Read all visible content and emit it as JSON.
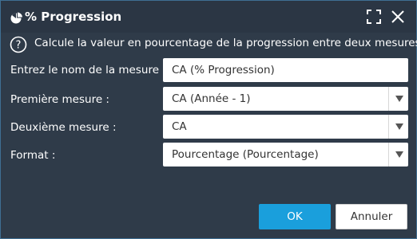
{
  "dialog": {
    "title": "% Progression",
    "title_icon": "pie-chart-icon",
    "maximize_icon": "maximize-icon",
    "close_icon": "close-icon"
  },
  "help": {
    "icon": "help-icon",
    "text": "Calcule la valeur en pourcentage de la progression entre deux mesures"
  },
  "form": {
    "measure_name": {
      "label": "Entrez le nom de la mesure :",
      "value": "CA (% Progression)"
    },
    "first_measure": {
      "label": "Première mesure :",
      "value": "CA (Année - 1)"
    },
    "second_measure": {
      "label": "Deuxième mesure :",
      "value": "CA"
    },
    "format": {
      "label": "Format :",
      "value": "Pourcentage (Pourcentage)"
    }
  },
  "buttons": {
    "ok": "OK",
    "cancel": "Annuler"
  },
  "colors": {
    "background": "#2f3b49",
    "accent": "#1a9fdc",
    "border": "#3f6f93"
  }
}
